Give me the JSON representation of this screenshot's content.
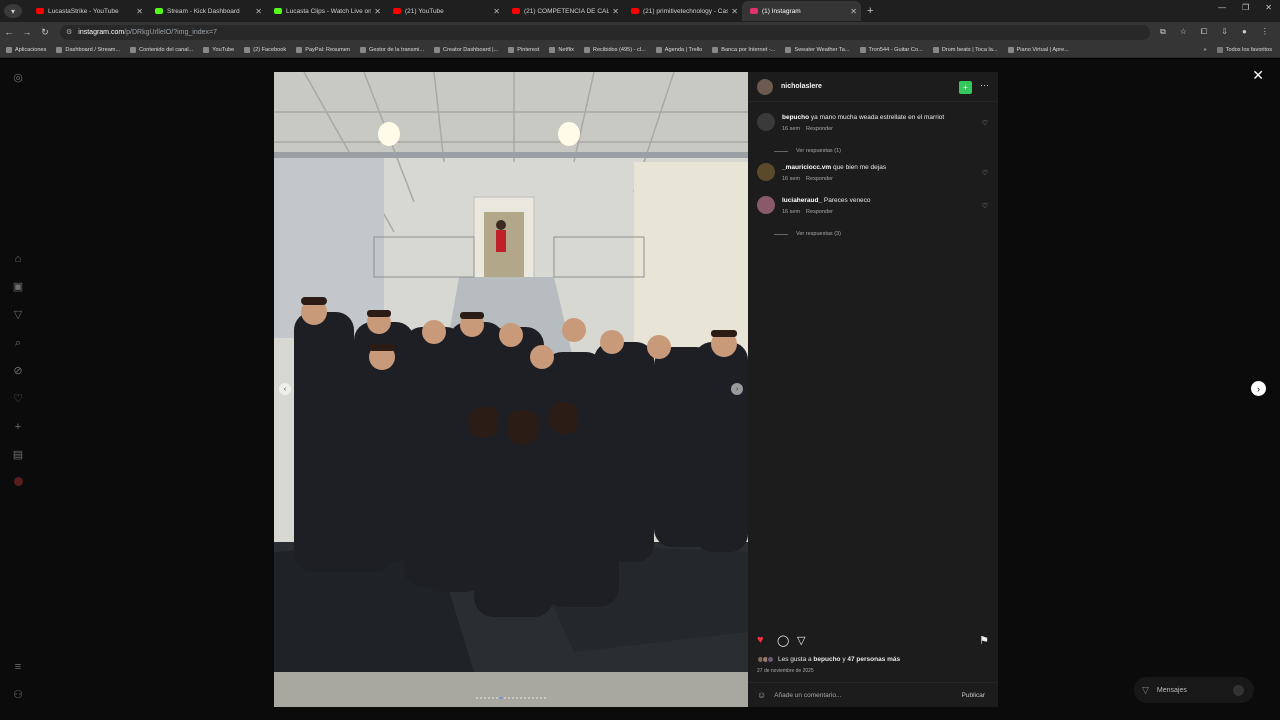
{
  "browser": {
    "tabs": [
      {
        "title": "LucastaStrike - YouTube",
        "color": "#ff0000"
      },
      {
        "title": "Stream - Kick Dashboard",
        "color": "#53fc18"
      },
      {
        "title": "Lucasta Clips - Watch Live on Kick",
        "color": "#53fc18"
      },
      {
        "title": "(21) YouTube",
        "color": "#ff0000"
      },
      {
        "title": "(21) COMPETENCIA DE CALABAZAS",
        "color": "#ff0000"
      },
      {
        "title": "(21) primitivetechnology - Castl",
        "color": "#ff0000"
      },
      {
        "title": "(1) Instagram",
        "color": "#e1306c",
        "active": true
      }
    ],
    "url_host": "instagram.com",
    "url_path": "/p/DRkgUrlleIO/?img_index=7",
    "bookmarks": [
      "Aplicaciones",
      "Dashboard / Stream...",
      "Contenido del canal...",
      "YouTube",
      "(2) Facebook",
      "PayPal: Resumen",
      "Gestor de la transmi...",
      "Creator Dashboard |...",
      "Pinterest",
      "Netflix",
      "Recibidos (495) - cl...",
      "Agenda | Trello",
      "Banca por Internet -...",
      "Sweater Weather Ta...",
      "Tron544 - Guitar Co...",
      "Drum beats | Toca la...",
      "Piano Virtual | Apre..."
    ],
    "bookmarks_all": "Todos los favoritos"
  },
  "post": {
    "username": "nicholaslere",
    "comments": [
      {
        "user": "bepucho",
        "text": "ya mano mucha weada estrellate en el marriot",
        "time": "16 sem",
        "reply": "Responder",
        "replies": "Ver respuestas (1)"
      },
      {
        "user": "_mauriciocc.vm",
        "text": "que bien me dejas",
        "time": "16 sem",
        "reply": "Responder",
        "replies": ""
      },
      {
        "user": "luciaheraud_",
        "text": "Pareces veneco",
        "time": "16 sem",
        "reply": "Responder",
        "replies": "Ver respuestas (3)"
      }
    ],
    "likes_prefix": "Les gusta a ",
    "likes_user": "bepucho",
    "likes_mid": " y ",
    "likes_others": "47 personas más",
    "date": "27 de noviembre de 2025",
    "add_comment_placeholder": "Añade un comentario...",
    "publish_label": "Publicar",
    "carousel_count": 18,
    "carousel_index": 7
  },
  "messages_label": "Mensajes",
  "colors": {
    "like": "#ff3040",
    "follow": "#34c759",
    "active_dot": "#3d8bff"
  }
}
